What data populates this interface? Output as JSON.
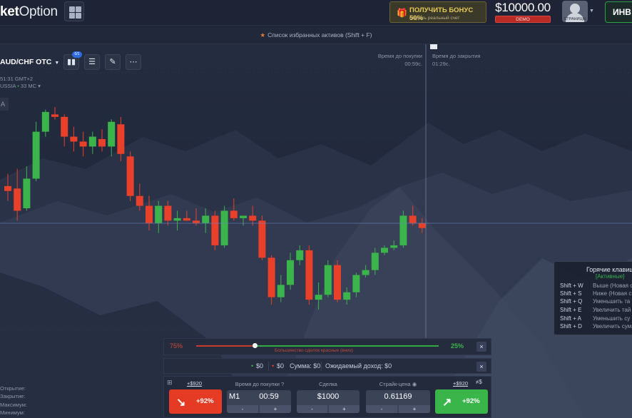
{
  "header": {
    "logo_bold": "ket",
    "logo_light": "Option",
    "bonus_title": "ПОЛУЧИТЬ БОНУС 50%",
    "bonus_sub": "открыть реальный счет",
    "balance": "$10000.00",
    "account_type": "DEMO",
    "avatar_label": "СТРАНИЦЫ",
    "invest_label": "ИНВ"
  },
  "favorites_bar": {
    "text": "Список избранных активов (Shift + F)"
  },
  "chart_toolbar": {
    "asset": "AUD/CHF OTC",
    "badge": "0/1",
    "time_info": "51:31 GMT+2",
    "region_info": "USSIA",
    "ping": "33 MC",
    "box_label": "A"
  },
  "chart": {
    "buy_time_label": "Время до покупки",
    "buy_time_value": "00:59c.",
    "close_time_label": "Время до закрытия",
    "close_time_value": "01:29c."
  },
  "chart_data": {
    "type": "candlestick",
    "candles": [
      {
        "o": 50,
        "h": 55,
        "l": 44,
        "c": 48
      },
      {
        "o": 49,
        "h": 57,
        "l": 36,
        "c": 40
      },
      {
        "o": 41,
        "h": 58,
        "l": 40,
        "c": 53
      },
      {
        "o": 53,
        "h": 76,
        "l": 52,
        "c": 72
      },
      {
        "o": 72,
        "h": 81,
        "l": 70,
        "c": 80
      },
      {
        "o": 79,
        "h": 82,
        "l": 77,
        "c": 78
      },
      {
        "o": 78,
        "h": 79,
        "l": 66,
        "c": 70
      },
      {
        "o": 70,
        "h": 74,
        "l": 64,
        "c": 68
      },
      {
        "o": 68,
        "h": 72,
        "l": 62,
        "c": 66
      },
      {
        "o": 66,
        "h": 72,
        "l": 63,
        "c": 70
      },
      {
        "o": 69,
        "h": 73,
        "l": 64,
        "c": 66
      },
      {
        "o": 66,
        "h": 77,
        "l": 62,
        "c": 76
      },
      {
        "o": 75,
        "h": 78,
        "l": 60,
        "c": 63
      },
      {
        "o": 62,
        "h": 64,
        "l": 44,
        "c": 46
      },
      {
        "o": 46,
        "h": 51,
        "l": 40,
        "c": 42
      },
      {
        "o": 42,
        "h": 46,
        "l": 32,
        "c": 35
      },
      {
        "o": 35,
        "h": 44,
        "l": 31,
        "c": 42
      },
      {
        "o": 42,
        "h": 44,
        "l": 34,
        "c": 36
      },
      {
        "o": 36,
        "h": 40,
        "l": 32,
        "c": 37
      },
      {
        "o": 37,
        "h": 40,
        "l": 36,
        "c": 36
      },
      {
        "o": 36,
        "h": 41,
        "l": 34,
        "c": 35
      },
      {
        "o": 35,
        "h": 41,
        "l": 31,
        "c": 38
      },
      {
        "o": 38,
        "h": 40,
        "l": 24,
        "c": 26
      },
      {
        "o": 26,
        "h": 42,
        "l": 25,
        "c": 40
      },
      {
        "o": 40,
        "h": 45,
        "l": 36,
        "c": 37
      },
      {
        "o": 37,
        "h": 38,
        "l": 34,
        "c": 38
      },
      {
        "o": 38,
        "h": 42,
        "l": 34,
        "c": 36
      },
      {
        "o": 36,
        "h": 38,
        "l": 20,
        "c": 21
      },
      {
        "o": 21,
        "h": 22,
        "l": 2,
        "c": 5
      },
      {
        "o": 5,
        "h": 14,
        "l": 3,
        "c": 10
      },
      {
        "o": 10,
        "h": 23,
        "l": 8,
        "c": 20
      },
      {
        "o": 20,
        "h": 26,
        "l": 18,
        "c": 24
      },
      {
        "o": 24,
        "h": 26,
        "l": 2,
        "c": 4
      },
      {
        "o": 4,
        "h": 11,
        "l": 0,
        "c": 6
      },
      {
        "o": 6,
        "h": 20,
        "l": 5,
        "c": 18
      },
      {
        "o": 18,
        "h": 20,
        "l": 3,
        "c": 4
      },
      {
        "o": 4,
        "h": 9,
        "l": 2,
        "c": 7
      },
      {
        "o": 7,
        "h": 15,
        "l": 5,
        "c": 14
      },
      {
        "o": 14,
        "h": 18,
        "l": 13,
        "c": 16
      },
      {
        "o": 16,
        "h": 25,
        "l": 14,
        "c": 23
      },
      {
        "o": 23,
        "h": 26,
        "l": 22,
        "c": 25
      },
      {
        "o": 25,
        "h": 28,
        "l": 24,
        "c": 26
      },
      {
        "o": 26,
        "h": 40,
        "l": 25,
        "c": 38
      },
      {
        "o": 38,
        "h": 42,
        "l": 34,
        "c": 35
      },
      {
        "o": 35,
        "h": 37,
        "l": 31,
        "c": 33
      }
    ]
  },
  "hotkeys": {
    "title": "Горячие клавиш",
    "status": "[Активные]",
    "rows": [
      {
        "key": "Shift + W",
        "desc": "Выше (Новая с"
      },
      {
        "key": "Shift + S",
        "desc": "Ниже (Новая с"
      },
      {
        "key": "Shift + Q",
        "desc": "Уменьшить та"
      },
      {
        "key": "Shift + E",
        "desc": "Увеличить тай"
      },
      {
        "key": "Shift + A",
        "desc": "Уменьшить су"
      },
      {
        "key": "Shift + D",
        "desc": "Увеличить сум"
      }
    ]
  },
  "sentiment": {
    "left_pct": "75%",
    "right_pct": "25%",
    "caption": "Большинство сделок красные (вниз)",
    "close": "×"
  },
  "payout": {
    "up": "$0",
    "down": "$0",
    "sum": "Сумма: $0",
    "expected": "Ожидаемый доход: $0",
    "close": "×"
  },
  "trade": {
    "down_payout": "+$920",
    "down_pct": "+92%",
    "time_label": "Время до покупки",
    "time_unit": "M1",
    "time_value": "00:59",
    "amount_label": "Сделка",
    "amount_value": "$1000",
    "strike_label": "Страйк-цена",
    "strike_value": "0.61169",
    "up_payout": "+$920",
    "up_pct": "+92%",
    "minus": "-",
    "plus": "+",
    "help": "?",
    "mode": "≠$",
    "expand": "⊞"
  },
  "left_stats": [
    "Открытие:",
    "Закрытие:",
    "Максимум:",
    "Минимум:"
  ],
  "colors": {
    "bull": "#3bb44c",
    "bear": "#e8402a",
    "accent": "#2e6be0"
  }
}
